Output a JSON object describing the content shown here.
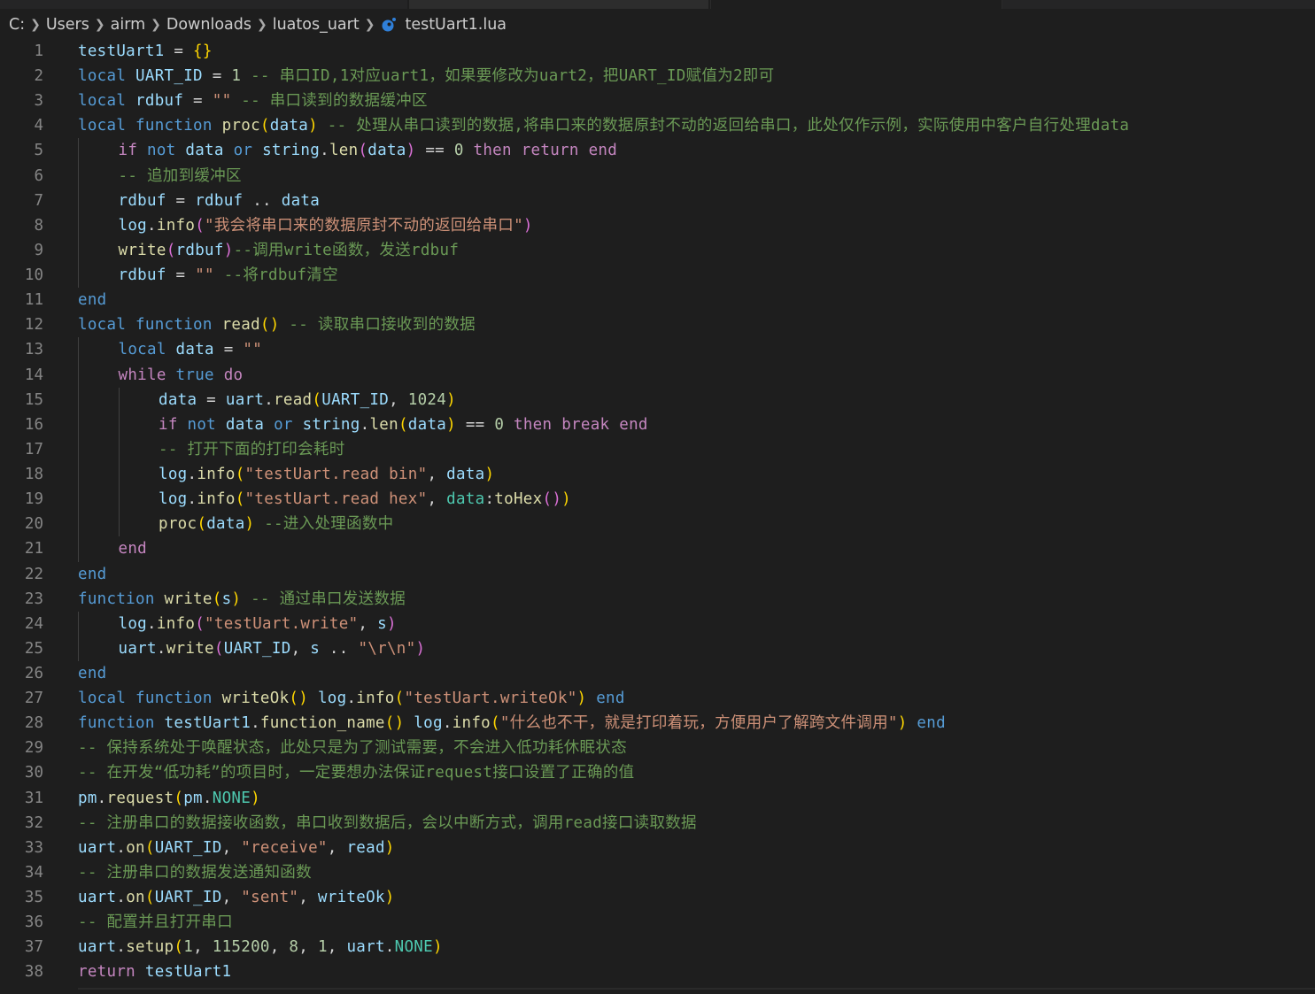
{
  "breadcrumb": {
    "items": [
      "C:",
      "Users",
      "airm",
      "Downloads",
      "luatos_uart"
    ],
    "file": "testUart1.lua"
  },
  "lines": [
    {
      "n": "1",
      "indent": 0,
      "tokens": [
        [
          "v",
          "testUart1"
        ],
        [
          "w",
          " = "
        ],
        [
          "y",
          "{}"
        ]
      ]
    },
    {
      "n": "2",
      "indent": 0,
      "tokens": [
        [
          "k",
          "local"
        ],
        [
          "w",
          " "
        ],
        [
          "v",
          "UART_ID"
        ],
        [
          "w",
          " = "
        ],
        [
          "n",
          "1"
        ],
        [
          "cm",
          " -- 串口ID,1对应uart1，如果要修改为uart2，把UART_ID赋值为2即可"
        ]
      ]
    },
    {
      "n": "3",
      "indent": 0,
      "tokens": [
        [
          "k",
          "local"
        ],
        [
          "w",
          " "
        ],
        [
          "v",
          "rdbuf"
        ],
        [
          "w",
          " = "
        ],
        [
          "s",
          "\"\""
        ],
        [
          "cm",
          " -- 串口读到的数据缓冲区"
        ]
      ]
    },
    {
      "n": "4",
      "indent": 0,
      "tokens": [
        [
          "k",
          "local"
        ],
        [
          "w",
          " "
        ],
        [
          "k",
          "function"
        ],
        [
          "w",
          " "
        ],
        [
          "f",
          "proc"
        ],
        [
          "y",
          "("
        ],
        [
          "v",
          "data"
        ],
        [
          "y",
          ")"
        ],
        [
          "cm",
          " -- 处理从串口读到的数据,将串口来的数据原封不动的返回给串口，此处仅作示例，实际使用中客户自行处理data"
        ]
      ]
    },
    {
      "n": "5",
      "indent": 1,
      "tokens": [
        [
          "c",
          "if"
        ],
        [
          "w",
          " "
        ],
        [
          "k",
          "not"
        ],
        [
          "w",
          " "
        ],
        [
          "v",
          "data"
        ],
        [
          "w",
          " "
        ],
        [
          "k",
          "or"
        ],
        [
          "w",
          " "
        ],
        [
          "v",
          "string"
        ],
        [
          "w",
          "."
        ],
        [
          "f",
          "len"
        ],
        [
          "p",
          "("
        ],
        [
          "v",
          "data"
        ],
        [
          "p",
          ")"
        ],
        [
          "w",
          " == "
        ],
        [
          "n",
          "0"
        ],
        [
          "w",
          " "
        ],
        [
          "c",
          "then"
        ],
        [
          "w",
          " "
        ],
        [
          "c",
          "return"
        ],
        [
          "w",
          " "
        ],
        [
          "c",
          "end"
        ]
      ]
    },
    {
      "n": "6",
      "indent": 1,
      "tokens": [
        [
          "cm",
          "-- 追加到缓冲区"
        ]
      ]
    },
    {
      "n": "7",
      "indent": 1,
      "tokens": [
        [
          "v",
          "rdbuf"
        ],
        [
          "w",
          " = "
        ],
        [
          "v",
          "rdbuf"
        ],
        [
          "w",
          " .. "
        ],
        [
          "v",
          "data"
        ]
      ]
    },
    {
      "n": "8",
      "indent": 1,
      "tokens": [
        [
          "v",
          "log"
        ],
        [
          "w",
          "."
        ],
        [
          "f",
          "info"
        ],
        [
          "p",
          "("
        ],
        [
          "s",
          "\"我会将串口来的数据原封不动的返回给串口\""
        ],
        [
          "p",
          ")"
        ]
      ]
    },
    {
      "n": "9",
      "indent": 1,
      "tokens": [
        [
          "f",
          "write"
        ],
        [
          "p",
          "("
        ],
        [
          "v",
          "rdbuf"
        ],
        [
          "p",
          ")"
        ],
        [
          "cm",
          "--调用write函数，发送rdbuf"
        ]
      ]
    },
    {
      "n": "10",
      "indent": 1,
      "tokens": [
        [
          "v",
          "rdbuf"
        ],
        [
          "w",
          " = "
        ],
        [
          "s",
          "\"\""
        ],
        [
          "cm",
          " --将rdbuf清空"
        ]
      ]
    },
    {
      "n": "11",
      "indent": 0,
      "tokens": [
        [
          "k",
          "end"
        ]
      ]
    },
    {
      "n": "12",
      "indent": 0,
      "tokens": [
        [
          "k",
          "local"
        ],
        [
          "w",
          " "
        ],
        [
          "k",
          "function"
        ],
        [
          "w",
          " "
        ],
        [
          "f",
          "read"
        ],
        [
          "y",
          "()"
        ],
        [
          "cm",
          " -- 读取串口接收到的数据"
        ]
      ]
    },
    {
      "n": "13",
      "indent": 1,
      "tokens": [
        [
          "k",
          "local"
        ],
        [
          "w",
          " "
        ],
        [
          "v",
          "data"
        ],
        [
          "w",
          " = "
        ],
        [
          "s",
          "\"\""
        ]
      ]
    },
    {
      "n": "14",
      "indent": 1,
      "tokens": [
        [
          "c",
          "while"
        ],
        [
          "w",
          " "
        ],
        [
          "k",
          "true"
        ],
        [
          "w",
          " "
        ],
        [
          "c",
          "do"
        ]
      ]
    },
    {
      "n": "15",
      "indent": 2,
      "tokens": [
        [
          "v",
          "data"
        ],
        [
          "w",
          " = "
        ],
        [
          "v",
          "uart"
        ],
        [
          "w",
          "."
        ],
        [
          "f",
          "read"
        ],
        [
          "y",
          "("
        ],
        [
          "v",
          "UART_ID"
        ],
        [
          "w",
          ", "
        ],
        [
          "n",
          "1024"
        ],
        [
          "y",
          ")"
        ]
      ]
    },
    {
      "n": "16",
      "indent": 2,
      "tokens": [
        [
          "c",
          "if"
        ],
        [
          "w",
          " "
        ],
        [
          "k",
          "not"
        ],
        [
          "w",
          " "
        ],
        [
          "v",
          "data"
        ],
        [
          "w",
          " "
        ],
        [
          "k",
          "or"
        ],
        [
          "w",
          " "
        ],
        [
          "v",
          "string"
        ],
        [
          "w",
          "."
        ],
        [
          "f",
          "len"
        ],
        [
          "y",
          "("
        ],
        [
          "v",
          "data"
        ],
        [
          "y",
          ")"
        ],
        [
          "w",
          " == "
        ],
        [
          "n",
          "0"
        ],
        [
          "w",
          " "
        ],
        [
          "c",
          "then"
        ],
        [
          "w",
          " "
        ],
        [
          "c",
          "break"
        ],
        [
          "w",
          " "
        ],
        [
          "c",
          "end"
        ]
      ]
    },
    {
      "n": "17",
      "indent": 2,
      "tokens": [
        [
          "cm",
          "-- 打开下面的打印会耗时"
        ]
      ]
    },
    {
      "n": "18",
      "indent": 2,
      "tokens": [
        [
          "v",
          "log"
        ],
        [
          "w",
          "."
        ],
        [
          "f",
          "info"
        ],
        [
          "y",
          "("
        ],
        [
          "s",
          "\"testUart.read bin\""
        ],
        [
          "w",
          ", "
        ],
        [
          "v",
          "data"
        ],
        [
          "y",
          ")"
        ]
      ]
    },
    {
      "n": "19",
      "indent": 2,
      "tokens": [
        [
          "v",
          "log"
        ],
        [
          "w",
          "."
        ],
        [
          "f",
          "info"
        ],
        [
          "y",
          "("
        ],
        [
          "s",
          "\"testUart.read hex\""
        ],
        [
          "w",
          ", "
        ],
        [
          "t",
          "data"
        ],
        [
          "w",
          ":"
        ],
        [
          "f",
          "toHex"
        ],
        [
          "p",
          "()"
        ],
        [
          "y",
          ")"
        ]
      ]
    },
    {
      "n": "20",
      "indent": 2,
      "tokens": [
        [
          "f",
          "proc"
        ],
        [
          "y",
          "("
        ],
        [
          "v",
          "data"
        ],
        [
          "y",
          ")"
        ],
        [
          "cm",
          " --进入处理函数中"
        ]
      ]
    },
    {
      "n": "21",
      "indent": 1,
      "tokens": [
        [
          "c",
          "end"
        ]
      ]
    },
    {
      "n": "22",
      "indent": 0,
      "tokens": [
        [
          "k",
          "end"
        ]
      ]
    },
    {
      "n": "23",
      "indent": 0,
      "tokens": [
        [
          "k",
          "function"
        ],
        [
          "w",
          " "
        ],
        [
          "f",
          "write"
        ],
        [
          "y",
          "("
        ],
        [
          "v",
          "s"
        ],
        [
          "y",
          ")"
        ],
        [
          "cm",
          " -- 通过串口发送数据"
        ]
      ]
    },
    {
      "n": "24",
      "indent": 1,
      "tokens": [
        [
          "v",
          "log"
        ],
        [
          "w",
          "."
        ],
        [
          "f",
          "info"
        ],
        [
          "p",
          "("
        ],
        [
          "s",
          "\"testUart.write\""
        ],
        [
          "w",
          ", "
        ],
        [
          "v",
          "s"
        ],
        [
          "p",
          ")"
        ]
      ]
    },
    {
      "n": "25",
      "indent": 1,
      "tokens": [
        [
          "v",
          "uart"
        ],
        [
          "w",
          "."
        ],
        [
          "f",
          "write"
        ],
        [
          "p",
          "("
        ],
        [
          "v",
          "UART_ID"
        ],
        [
          "w",
          ", "
        ],
        [
          "v",
          "s"
        ],
        [
          "w",
          " .. "
        ],
        [
          "s",
          "\"\\r\\n\""
        ],
        [
          "p",
          ")"
        ]
      ]
    },
    {
      "n": "26",
      "indent": 0,
      "tokens": [
        [
          "k",
          "end"
        ]
      ]
    },
    {
      "n": "27",
      "indent": 0,
      "tokens": [
        [
          "k",
          "local"
        ],
        [
          "w",
          " "
        ],
        [
          "k",
          "function"
        ],
        [
          "w",
          " "
        ],
        [
          "f",
          "writeOk"
        ],
        [
          "y",
          "()"
        ],
        [
          "w",
          " "
        ],
        [
          "v",
          "log"
        ],
        [
          "w",
          "."
        ],
        [
          "f",
          "info"
        ],
        [
          "y",
          "("
        ],
        [
          "s",
          "\"testUart.writeOk\""
        ],
        [
          "y",
          ")"
        ],
        [
          "w",
          " "
        ],
        [
          "k",
          "end"
        ]
      ]
    },
    {
      "n": "28",
      "indent": 0,
      "tokens": [
        [
          "k",
          "function"
        ],
        [
          "w",
          " "
        ],
        [
          "v",
          "testUart1"
        ],
        [
          "w",
          "."
        ],
        [
          "f",
          "function_name"
        ],
        [
          "y",
          "()"
        ],
        [
          "w",
          " "
        ],
        [
          "v",
          "log"
        ],
        [
          "w",
          "."
        ],
        [
          "f",
          "info"
        ],
        [
          "y",
          "("
        ],
        [
          "s",
          "\"什么也不干，就是打印着玩，方便用户了解跨文件调用\""
        ],
        [
          "y",
          ")"
        ],
        [
          "w",
          " "
        ],
        [
          "k",
          "end"
        ]
      ]
    },
    {
      "n": "29",
      "indent": 0,
      "tokens": [
        [
          "cm",
          "-- 保持系统处于唤醒状态，此处只是为了测试需要，不会进入低功耗休眠状态"
        ]
      ]
    },
    {
      "n": "30",
      "indent": 0,
      "tokens": [
        [
          "cm",
          "-- 在开发“低功耗”的项目时，一定要想办法保证request接口设置了正确的值"
        ]
      ]
    },
    {
      "n": "31",
      "indent": 0,
      "tokens": [
        [
          "v",
          "pm"
        ],
        [
          "w",
          "."
        ],
        [
          "f",
          "request"
        ],
        [
          "y",
          "("
        ],
        [
          "v",
          "pm"
        ],
        [
          "w",
          "."
        ],
        [
          "t",
          "NONE"
        ],
        [
          "y",
          ")"
        ]
      ]
    },
    {
      "n": "32",
      "indent": 0,
      "tokens": [
        [
          "cm",
          "-- 注册串口的数据接收函数，串口收到数据后，会以中断方式，调用read接口读取数据"
        ]
      ]
    },
    {
      "n": "33",
      "indent": 0,
      "tokens": [
        [
          "v",
          "uart"
        ],
        [
          "w",
          "."
        ],
        [
          "f",
          "on"
        ],
        [
          "y",
          "("
        ],
        [
          "v",
          "UART_ID"
        ],
        [
          "w",
          ", "
        ],
        [
          "s",
          "\"receive\""
        ],
        [
          "w",
          ", "
        ],
        [
          "v",
          "read"
        ],
        [
          "y",
          ")"
        ]
      ]
    },
    {
      "n": "34",
      "indent": 0,
      "tokens": [
        [
          "cm",
          "-- 注册串口的数据发送通知函数"
        ]
      ]
    },
    {
      "n": "35",
      "indent": 0,
      "tokens": [
        [
          "v",
          "uart"
        ],
        [
          "w",
          "."
        ],
        [
          "f",
          "on"
        ],
        [
          "y",
          "("
        ],
        [
          "v",
          "UART_ID"
        ],
        [
          "w",
          ", "
        ],
        [
          "s",
          "\"sent\""
        ],
        [
          "w",
          ", "
        ],
        [
          "v",
          "writeOk"
        ],
        [
          "y",
          ")"
        ]
      ]
    },
    {
      "n": "36",
      "indent": 0,
      "tokens": [
        [
          "cm",
          "-- 配置并且打开串口"
        ]
      ]
    },
    {
      "n": "37",
      "indent": 0,
      "tokens": [
        [
          "v",
          "uart"
        ],
        [
          "w",
          "."
        ],
        [
          "f",
          "setup"
        ],
        [
          "y",
          "("
        ],
        [
          "n",
          "1"
        ],
        [
          "w",
          ", "
        ],
        [
          "n",
          "115200"
        ],
        [
          "w",
          ", "
        ],
        [
          "n",
          "8"
        ],
        [
          "w",
          ", "
        ],
        [
          "n",
          "1"
        ],
        [
          "w",
          ", "
        ],
        [
          "v",
          "uart"
        ],
        [
          "w",
          "."
        ],
        [
          "t",
          "NONE"
        ],
        [
          "y",
          ")"
        ]
      ]
    },
    {
      "n": "38",
      "indent": 0,
      "tokens": [
        [
          "c",
          "return"
        ],
        [
          "w",
          " "
        ],
        [
          "v",
          "testUart1"
        ]
      ]
    }
  ]
}
